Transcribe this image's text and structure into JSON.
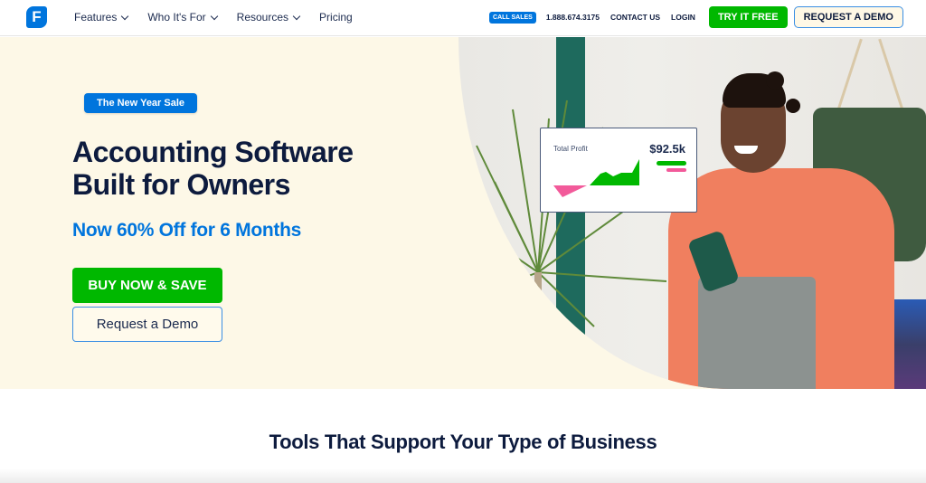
{
  "nav": {
    "logo_letter": "F",
    "items": [
      {
        "label": "Features",
        "has_dropdown": true
      },
      {
        "label": "Who It's For",
        "has_dropdown": true
      },
      {
        "label": "Resources",
        "has_dropdown": true
      },
      {
        "label": "Pricing",
        "has_dropdown": false
      }
    ],
    "call_sales_label": "CALL SALES",
    "phone": "1.888.674.3175",
    "contact_label": "CONTACT US",
    "login_label": "LOGIN",
    "try_free_label": "TRY IT FREE",
    "request_demo_label": "REQUEST A DEMO"
  },
  "hero": {
    "badge": "The New Year Sale",
    "headline_line1": "Accounting Software",
    "headline_line2": "Built for Owners",
    "subhead": "Now 60% Off for 6 Months",
    "buy_button": "BUY NOW & SAVE",
    "demo_button": "Request a Demo",
    "profit_card": {
      "label": "Total Profit",
      "value": "$92.5k"
    }
  },
  "section": {
    "title": "Tools That Support Your Type of Business"
  },
  "colors": {
    "brand_blue": "#0075dd",
    "cta_green": "#00b800",
    "navy": "#0d1b3e",
    "hero_bg": "#fdf8e7",
    "loss_pink": "#f25a9a"
  }
}
